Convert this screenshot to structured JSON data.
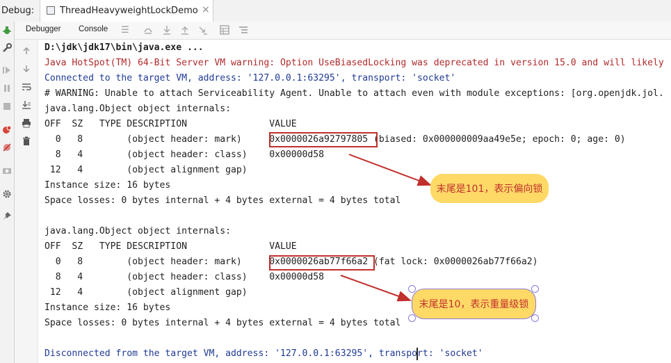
{
  "topbar": {
    "debug_label": "Debug:",
    "session_tab": {
      "label": "ThreadHeavyweightLockDemo",
      "close": "×"
    }
  },
  "toolbar": {
    "tabs": [
      {
        "label": "Debugger"
      },
      {
        "label": "Console"
      }
    ],
    "icons": [
      "menu-icon",
      "show-execution-point-icon",
      "step-over-icon",
      "step-into-icon",
      "step-out-icon",
      "run-to-cursor-icon",
      "evaluate-icon",
      "trace-icon"
    ]
  },
  "left_toolbar": {
    "icons": [
      "debug-bug-icon",
      "wrench-icon",
      "resume-icon",
      "pause-icon",
      "stop-icon",
      "view-breakpoints-icon",
      "mute-breakpoints-icon",
      "camera-icon",
      "settings-icon",
      "pin-icon"
    ]
  },
  "console_gutter": {
    "icons": [
      "up-arrow-icon",
      "down-arrow-icon",
      "soft-wrap-icon",
      "scroll-to-end-icon",
      "print-icon",
      "trash-icon"
    ]
  },
  "console": {
    "lines": [
      {
        "text": "D:\\jdk\\jdk17\\bin\\java.exe ...",
        "kind": "cmd"
      },
      {
        "text": "Java HotSpot(TM) 64-Bit Server VM warning: Option UseBiasedLocking was deprecated in version 15.0 and will likely",
        "kind": "err"
      },
      {
        "text": "Connected to the target VM, address: '127.0.0.1:63295', transport: 'socket'",
        "kind": "sys"
      },
      {
        "text": "# WARNING: Unable to attach Serviceability Agent. Unable to attach even with module exceptions: [org.openjdk.jol.",
        "kind": "out"
      },
      {
        "text": "java.lang.Object object internals:",
        "kind": "out"
      },
      {
        "text": "OFF  SZ   TYPE DESCRIPTION               VALUE",
        "kind": "out"
      },
      {
        "text": "  0   8        (object header: mark)     0x0000026a92797805 (biased: 0x000000009aa49e5e; epoch: 0; age: 0)",
        "kind": "out"
      },
      {
        "text": "  8   4        (object header: class)    0x00000d58",
        "kind": "out"
      },
      {
        "text": " 12   4        (object alignment gap)",
        "kind": "out"
      },
      {
        "text": "Instance size: 16 bytes",
        "kind": "out"
      },
      {
        "text": "Space losses: 0 bytes internal + 4 bytes external = 4 bytes total",
        "kind": "out"
      },
      {
        "text": "",
        "kind": "out"
      },
      {
        "text": "java.lang.Object object internals:",
        "kind": "out"
      },
      {
        "text": "OFF  SZ   TYPE DESCRIPTION               VALUE",
        "kind": "out"
      },
      {
        "text": "  0   8        (object header: mark)     0x0000026ab77f66a2 (fat lock: 0x0000026ab77f66a2)",
        "kind": "out"
      },
      {
        "text": "  8   4        (object header: class)    0x00000d58",
        "kind": "out"
      },
      {
        "text": " 12   4        (object alignment gap)",
        "kind": "out"
      },
      {
        "text": "Instance size: 16 bytes",
        "kind": "out"
      },
      {
        "text": "Space losses: 0 bytes internal + 4 bytes external = 4 bytes total",
        "kind": "out"
      },
      {
        "text": "",
        "kind": "out"
      },
      {
        "text": "Disconnected from the target VM, address: '127.0.0.1:63295', transport: 'socket'",
        "kind": "sys"
      }
    ]
  },
  "annotations": [
    {
      "text": "末尾是101，表示偏向锁"
    },
    {
      "text": "末尾是10，表示重量级锁"
    }
  ],
  "colors": {
    "annotation_red": "#c0302c",
    "callout_fill": "#ffd966",
    "selection_purple": "#8c7ad8",
    "error_text": "#b12a2a",
    "system_text": "#1f3a93"
  }
}
